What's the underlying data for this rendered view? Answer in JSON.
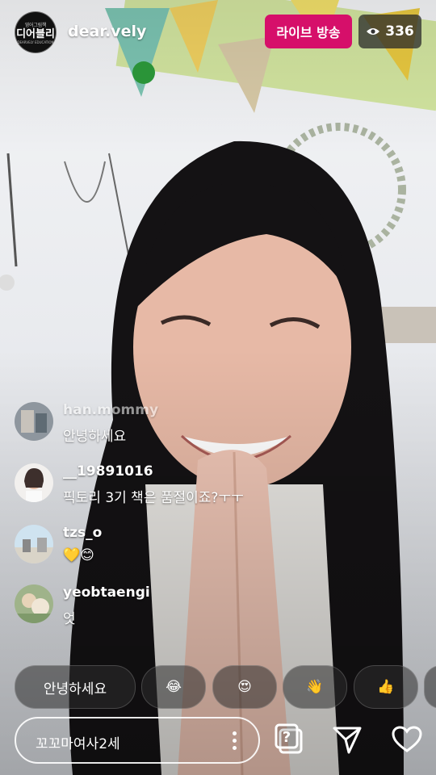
{
  "header": {
    "avatar": {
      "small_text": "영어그림책",
      "main_text": "디어블리",
      "sub_text": "DEARVELY EDUCATION"
    },
    "username": "dear.vely",
    "live_label": "라이브 방송",
    "viewer_count": "336",
    "colors": {
      "live": "#d60f6a"
    }
  },
  "comments": [
    {
      "user": "han.mommy",
      "text": "안녕하세요"
    },
    {
      "user": "__19891016",
      "text": "픽토리 3기 책은 품절이죠?ㅜㅜ"
    },
    {
      "user": "tzs_o",
      "text": "💛😊"
    },
    {
      "user": "yeobtaengi",
      "text": "엇"
    }
  ],
  "quick_replies": {
    "greeting": "안녕하세요",
    "laugh": "😂",
    "heart_eyes": "😍",
    "wave": "👋",
    "thumbs_up": "👍"
  },
  "composer": {
    "text": "꼬꼬마여사2세"
  }
}
